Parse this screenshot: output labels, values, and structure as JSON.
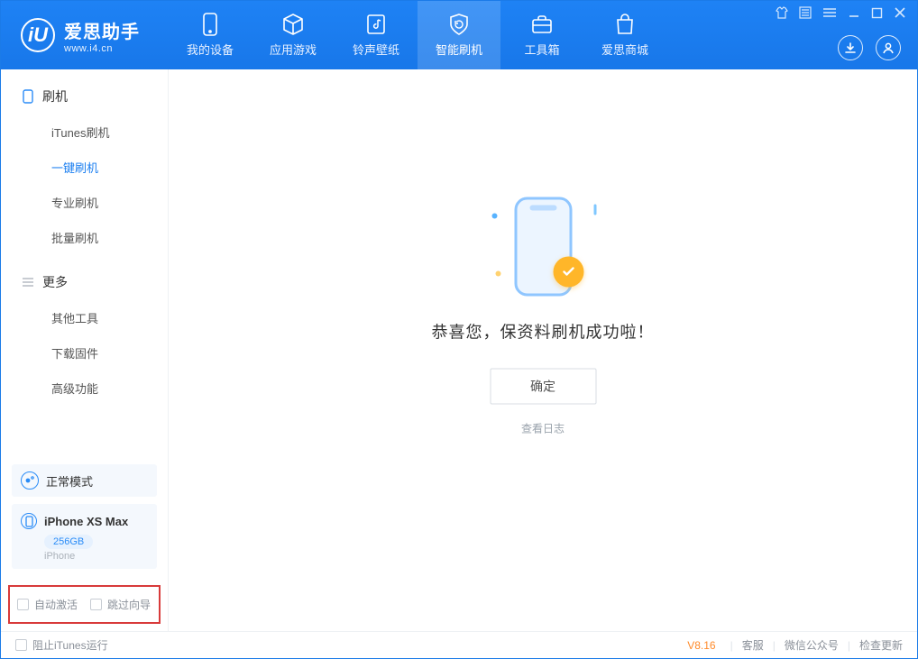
{
  "app": {
    "name": "爱思助手",
    "site": "www.i4.cn",
    "logo_letter": "iU"
  },
  "tabs": {
    "my_device": "我的设备",
    "apps_games": "应用游戏",
    "ring_wall": "铃声壁纸",
    "smart_flash": "智能刷机",
    "toolbox": "工具箱",
    "store": "爱思商城"
  },
  "sidebar": {
    "group_flash": "刷机",
    "items_flash": [
      "iTunes刷机",
      "一键刷机",
      "专业刷机",
      "批量刷机"
    ],
    "group_more": "更多",
    "items_more": [
      "其他工具",
      "下载固件",
      "高级功能"
    ],
    "active_item": "一键刷机"
  },
  "mode_card": {
    "label": "正常模式"
  },
  "device": {
    "name": "iPhone XS Max",
    "storage": "256GB",
    "type": "iPhone"
  },
  "options": {
    "auto_activate": "自动激活",
    "skip_guide": "跳过向导"
  },
  "main": {
    "message": "恭喜您，保资料刷机成功啦！",
    "ok": "确定",
    "view_log": "查看日志"
  },
  "status": {
    "block_itunes": "阻止iTunes运行",
    "version": "V8.16",
    "links": [
      "客服",
      "微信公众号",
      "检查更新"
    ]
  }
}
